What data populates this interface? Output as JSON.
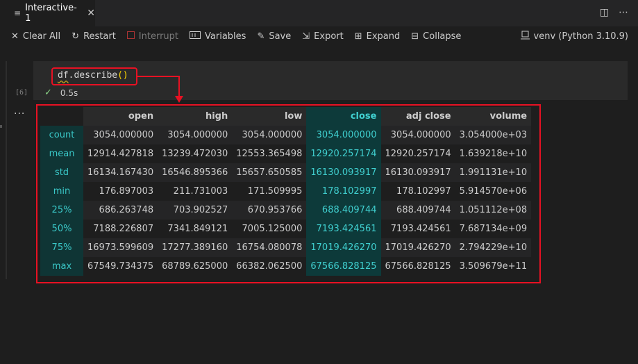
{
  "tab": {
    "title": "Interactive-1",
    "close_glyph": "✕",
    "icon": "notebook-icon"
  },
  "tabbar_actions": [
    {
      "name": "split-editor-icon",
      "glyph": "◫"
    },
    {
      "name": "more-actions-icon",
      "glyph": "⋯"
    }
  ],
  "toolbar": {
    "clear_all": "Clear All",
    "restart": "Restart",
    "interrupt": "Interrupt",
    "variables": "Variables",
    "save": "Save",
    "export": "Export",
    "expand": "Expand",
    "collapse": "Collapse"
  },
  "kernel": {
    "label": "venv (Python 3.10.9)"
  },
  "cell": {
    "execution_count": "[6]",
    "code_obj": "df",
    "code_method": ".describe",
    "code_parens": "()",
    "duration": "0.5s"
  },
  "output_menu": "...",
  "table": {
    "columns": [
      "open",
      "high",
      "low",
      "close",
      "adj close",
      "volume"
    ],
    "selected_column": "close",
    "rows": [
      {
        "label": "count",
        "values": [
          "3054.000000",
          "3054.000000",
          "3054.000000",
          "3054.000000",
          "3054.000000",
          "3.054000e+03"
        ]
      },
      {
        "label": "mean",
        "values": [
          "12914.427818",
          "13239.472030",
          "12553.365498",
          "12920.257174",
          "12920.257174",
          "1.639218e+10"
        ]
      },
      {
        "label": "std",
        "values": [
          "16134.167430",
          "16546.895366",
          "15657.650585",
          "16130.093917",
          "16130.093917",
          "1.991131e+10"
        ]
      },
      {
        "label": "min",
        "values": [
          "176.897003",
          "211.731003",
          "171.509995",
          "178.102997",
          "178.102997",
          "5.914570e+06"
        ]
      },
      {
        "label": "25%",
        "values": [
          "686.263748",
          "703.902527",
          "670.953766",
          "688.409744",
          "688.409744",
          "1.051112e+08"
        ]
      },
      {
        "label": "50%",
        "values": [
          "7188.226807",
          "7341.849121",
          "7005.125000",
          "7193.424561",
          "7193.424561",
          "7.687134e+09"
        ]
      },
      {
        "label": "75%",
        "values": [
          "16973.599609",
          "17277.389160",
          "16754.080078",
          "17019.426270",
          "17019.426270",
          "2.794229e+10"
        ]
      },
      {
        "label": "max",
        "values": [
          "67549.734375",
          "68789.625000",
          "66382.062500",
          "67566.828125",
          "67566.828125",
          "3.509679e+11"
        ]
      }
    ]
  },
  "colors": {
    "accent_teal": "#3ac8c8",
    "highlight_red": "#e81123",
    "success_green": "#89d185"
  }
}
